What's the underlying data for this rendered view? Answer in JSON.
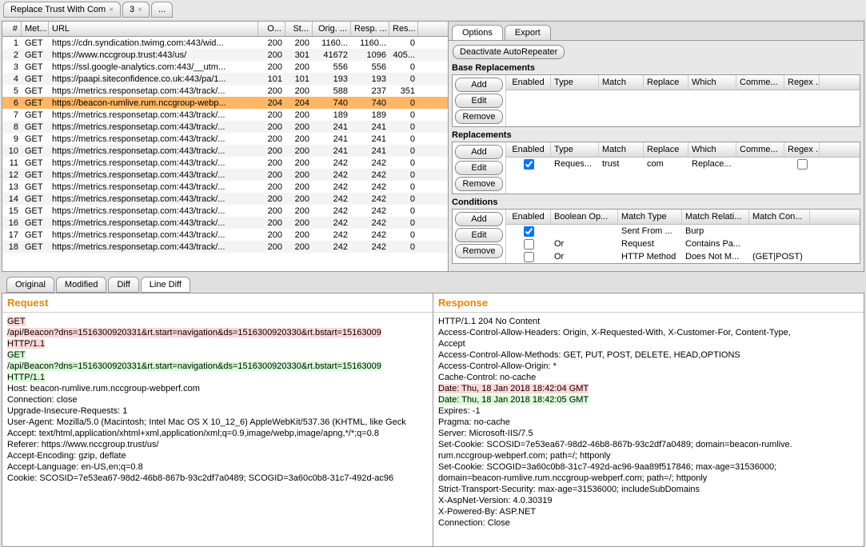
{
  "tabs": [
    "Replace Trust With Com",
    "3",
    "..."
  ],
  "tableHeaders": [
    "#",
    "Met...",
    "URL",
    "O...",
    "St...",
    "Orig. ...",
    "Resp. ...",
    "Res..."
  ],
  "rows": [
    {
      "n": 1,
      "m": "GET",
      "u": "https://cdn.syndication.twimg.com:443/wid...",
      "o": 200,
      "s": 200,
      "ol": "1160...",
      "rl": "1160...",
      "rs": 0
    },
    {
      "n": 2,
      "m": "GET",
      "u": "https://www.nccgroup.trust:443/us/",
      "o": 200,
      "s": 301,
      "ol": 41672,
      "rl": 1096,
      "rs": "405..."
    },
    {
      "n": 3,
      "m": "GET",
      "u": "https://ssl.google-analytics.com:443/__utm...",
      "o": 200,
      "s": 200,
      "ol": 556,
      "rl": 556,
      "rs": 0
    },
    {
      "n": 4,
      "m": "GET",
      "u": "https://paapi.siteconfidence.co.uk:443/pa/1...",
      "o": 101,
      "s": 101,
      "ol": 193,
      "rl": 193,
      "rs": 0
    },
    {
      "n": 5,
      "m": "GET",
      "u": "https://metrics.responsetap.com:443/track/...",
      "o": 200,
      "s": 200,
      "ol": 588,
      "rl": 237,
      "rs": 351
    },
    {
      "n": 6,
      "m": "GET",
      "u": "https://beacon-rumlive.rum.nccgroup-webp...",
      "o": 204,
      "s": 204,
      "ol": 740,
      "rl": 740,
      "rs": 0,
      "sel": true
    },
    {
      "n": 7,
      "m": "GET",
      "u": "https://metrics.responsetap.com:443/track/...",
      "o": 200,
      "s": 200,
      "ol": 189,
      "rl": 189,
      "rs": 0
    },
    {
      "n": 8,
      "m": "GET",
      "u": "https://metrics.responsetap.com:443/track/...",
      "o": 200,
      "s": 200,
      "ol": 241,
      "rl": 241,
      "rs": 0
    },
    {
      "n": 9,
      "m": "GET",
      "u": "https://metrics.responsetap.com:443/track/...",
      "o": 200,
      "s": 200,
      "ol": 241,
      "rl": 241,
      "rs": 0
    },
    {
      "n": 10,
      "m": "GET",
      "u": "https://metrics.responsetap.com:443/track/...",
      "o": 200,
      "s": 200,
      "ol": 241,
      "rl": 241,
      "rs": 0
    },
    {
      "n": 11,
      "m": "GET",
      "u": "https://metrics.responsetap.com:443/track/...",
      "o": 200,
      "s": 200,
      "ol": 242,
      "rl": 242,
      "rs": 0
    },
    {
      "n": 12,
      "m": "GET",
      "u": "https://metrics.responsetap.com:443/track/...",
      "o": 200,
      "s": 200,
      "ol": 242,
      "rl": 242,
      "rs": 0
    },
    {
      "n": 13,
      "m": "GET",
      "u": "https://metrics.responsetap.com:443/track/...",
      "o": 200,
      "s": 200,
      "ol": 242,
      "rl": 242,
      "rs": 0
    },
    {
      "n": 14,
      "m": "GET",
      "u": "https://metrics.responsetap.com:443/track/...",
      "o": 200,
      "s": 200,
      "ol": 242,
      "rl": 242,
      "rs": 0
    },
    {
      "n": 15,
      "m": "GET",
      "u": "https://metrics.responsetap.com:443/track/...",
      "o": 200,
      "s": 200,
      "ol": 242,
      "rl": 242,
      "rs": 0
    },
    {
      "n": 16,
      "m": "GET",
      "u": "https://metrics.responsetap.com:443/track/...",
      "o": 200,
      "s": 200,
      "ol": 242,
      "rl": 242,
      "rs": 0
    },
    {
      "n": 17,
      "m": "GET",
      "u": "https://metrics.responsetap.com:443/track/...",
      "o": 200,
      "s": 200,
      "ol": 242,
      "rl": 242,
      "rs": 0
    },
    {
      "n": 18,
      "m": "GET",
      "u": "https://metrics.responsetap.com:443/track/...",
      "o": 200,
      "s": 200,
      "ol": 242,
      "rl": 242,
      "rs": 0
    }
  ],
  "rightTabs": [
    "Options",
    "Export"
  ],
  "deactivate": "Deactivate AutoRepeater",
  "baseTitle": "Base Replacements",
  "replTitle": "Replacements",
  "condTitle": "Conditions",
  "btns": {
    "add": "Add",
    "edit": "Edit",
    "remove": "Remove"
  },
  "baseHeaders": [
    "Enabled",
    "Type",
    "Match",
    "Replace",
    "Which",
    "Comme...",
    "Regex ..."
  ],
  "replHeaders": [
    "Enabled",
    "Type",
    "Match",
    "Replace",
    "Which",
    "Comme...",
    "Regex ..."
  ],
  "replRow": {
    "en": true,
    "ty": "Reques...",
    "ma": "trust",
    "re": "com",
    "wh": "Replace...",
    "co": "",
    "rg": false
  },
  "condHeaders": [
    "Enabled",
    "Boolean Op...",
    "Match Type",
    "Match Relati...",
    "Match Con..."
  ],
  "condRows": [
    {
      "en": true,
      "bo": "",
      "mt": "Sent From ...",
      "mr": "Burp",
      "mc": ""
    },
    {
      "en": false,
      "bo": "Or",
      "mt": "Request",
      "mr": "Contains Pa...",
      "mc": ""
    },
    {
      "en": false,
      "bo": "Or",
      "mt": "HTTP Method",
      "mr": "Does Not M...",
      "mc": "(GET|POST)"
    }
  ],
  "bottomTabs": [
    "Original",
    "Modified",
    "Diff",
    "Line Diff"
  ],
  "reqTitle": "Request",
  "respTitle": "Response",
  "request": {
    "l1": "GET",
    "l2": "/api/Beacon?dns=1516300920331&rt.start=navigation&ds=1516300920330&rt.bstart=15163009",
    "l3": "HTTP/1.1",
    "l4": "GET",
    "l5": "/api/Beacon?dns=1516300920331&rt.start=navigation&ds=1516300920330&rt.bstart=15163009",
    "l6": "HTTP/1.1",
    "rest": [
      "Host: beacon-rumlive.rum.nccgroup-webperf.com",
      "Connection: close",
      "Upgrade-Insecure-Requests: 1",
      "User-Agent: Mozilla/5.0 (Macintosh; Intel Mac OS X 10_12_6) AppleWebKit/537.36 (KHTML, like Geck",
      "Accept: text/html,application/xhtml+xml,application/xml;q=0.9,image/webp,image/apng,*/*;q=0.8",
      "Referer: https://www.nccgroup.trust/us/",
      "Accept-Encoding: gzip, deflate",
      "Accept-Language: en-US,en;q=0.8",
      "Cookie: SCOSID=7e53ea67-98d2-46b8-867b-93c2df7a0489; SCOGID=3a60c0b8-31c7-492d-ac96"
    ]
  },
  "response": {
    "pre": [
      "HTTP/1.1 204 No Content",
      "Access-Control-Allow-Headers: Origin, X-Requested-With, X-Customer-For, Content-Type,",
      "Accept",
      "Access-Control-Allow-Methods: GET, PUT, POST, DELETE, HEAD,OPTIONS",
      "Access-Control-Allow-Origin: *",
      "Cache-Control: no-cache"
    ],
    "d1": "Date: Thu, 18 Jan 2018 18:42:04 GMT",
    "d2": "Date: Thu, 18 Jan 2018 18:42:05 GMT",
    "post": [
      "Expires: -1",
      "Pragma: no-cache",
      "Server: Microsoft-IIS/7.5",
      "Set-Cookie: SCOSID=7e53ea67-98d2-46b8-867b-93c2df7a0489; domain=beacon-rumlive.",
      "rum.nccgroup-webperf.com; path=/; httponly",
      "Set-Cookie: SCOGID=3a60c0b8-31c7-492d-ac96-9aa89f517846; max-age=31536000;",
      "domain=beacon-rumlive.rum.nccgroup-webperf.com; path=/; httponly",
      "Strict-Transport-Security: max-age=31536000; includeSubDomains",
      "X-AspNet-Version: 4.0.30319",
      "X-Powered-By: ASP.NET",
      "Connection: Close"
    ]
  }
}
